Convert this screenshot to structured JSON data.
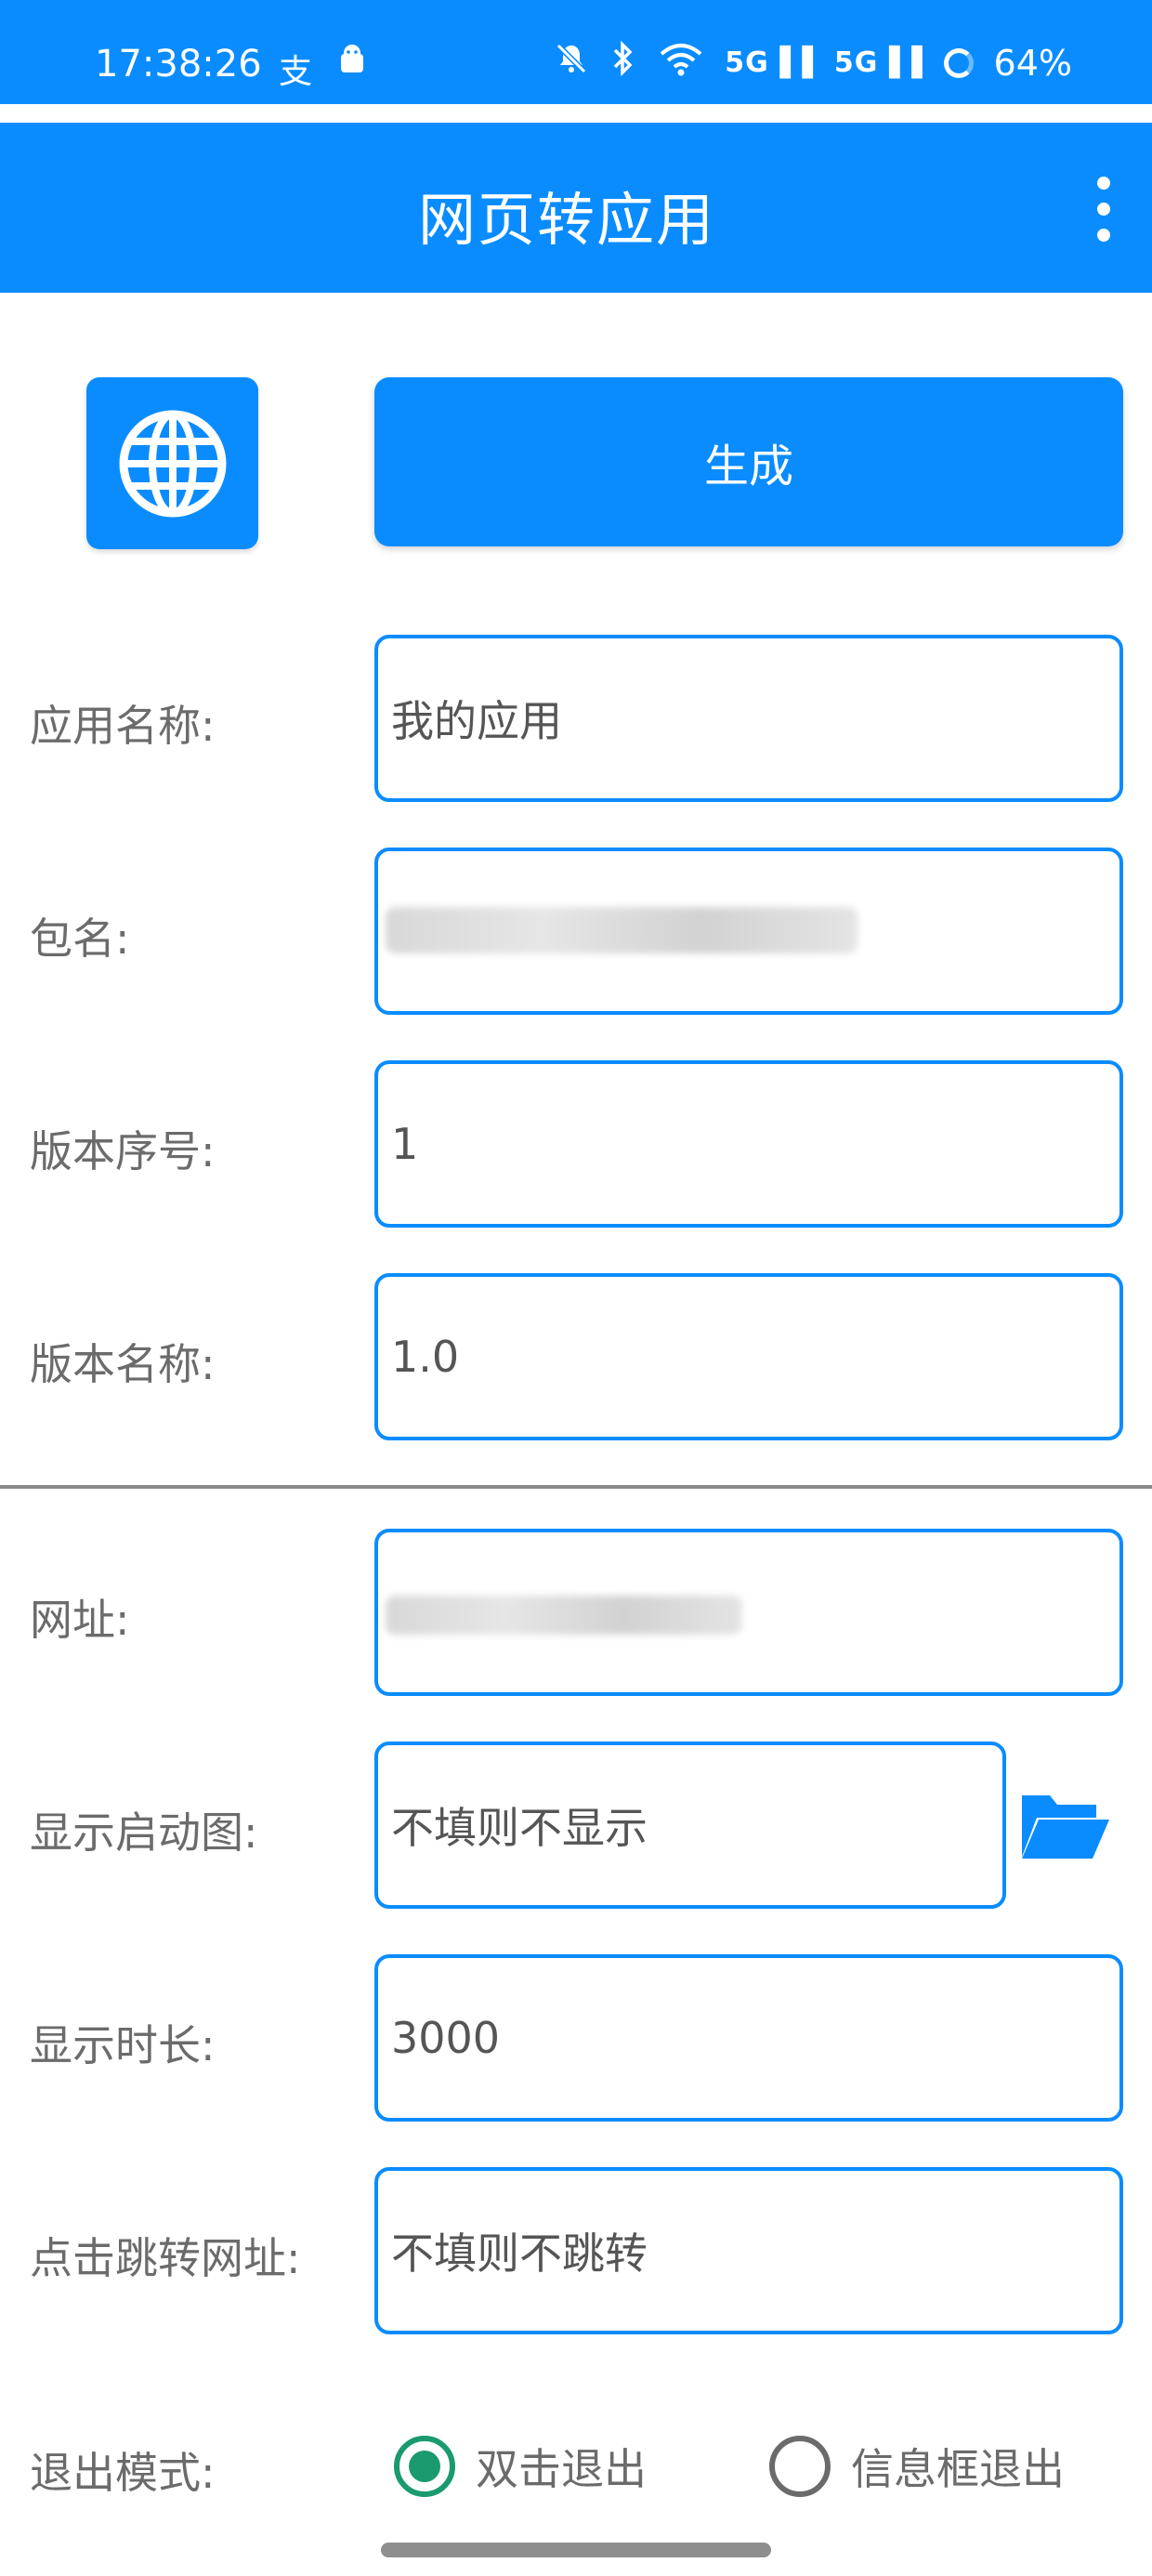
{
  "status_bar": {
    "time": "17:38:26",
    "battery": "64%",
    "signal_label_1": "5G",
    "signal_label_2": "5G"
  },
  "app_bar": {
    "title": "网页转应用"
  },
  "toolbar": {
    "generate_label": "生成"
  },
  "form": {
    "app_name_label": "应用名称:",
    "app_name_value": "我的应用",
    "package_label": "包名:",
    "version_code_label": "版本序号:",
    "version_code_value": "1",
    "version_name_label": "版本名称:",
    "version_name_value": "1.0",
    "url_label": "网址:",
    "splash_label": "显示启动图:",
    "splash_placeholder": "不填则不显示",
    "duration_label": "显示时长:",
    "duration_value": "3000",
    "click_url_label": "点击跳转网址:",
    "click_url_placeholder": "不填则不跳转",
    "exit_mode_label": "退出模式:",
    "exit_options": [
      {
        "label": "双击退出",
        "checked": true
      },
      {
        "label": "信息框退出",
        "checked": false
      }
    ]
  },
  "colors": {
    "primary": "#0a8cff",
    "radio_checked": "#1a9a6e",
    "label_text": "#6b6b6b"
  }
}
